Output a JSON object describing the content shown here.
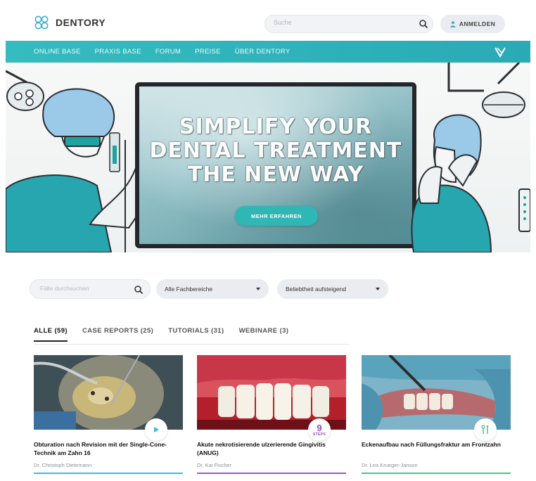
{
  "header": {
    "brand": "DENTORY",
    "search_placeholder": "Suche",
    "login_label": "ANMELDEN"
  },
  "nav": {
    "items": [
      "ONLINE BASE",
      "PRAXIS BASE",
      "FORUM",
      "PREISE",
      "ÜBER DENTORY"
    ]
  },
  "hero": {
    "line1": "SIMPLIFY YOUR",
    "line2": "DENTAL TREATMENT",
    "line3": "THE NEW WAY",
    "cta_label": "MEHR ERFAHREN"
  },
  "filters": {
    "search_placeholder": "Fälle durchsuchen",
    "category_value": "Alle Fachbereiche",
    "sort_value": "Beliebtheit aufsteigend"
  },
  "tabs": [
    {
      "label": "ALLE (59)",
      "active": true
    },
    {
      "label": "CASE REPORTS (25)",
      "active": false
    },
    {
      "label": "TUTORIALS (31)",
      "active": false
    },
    {
      "label": "WEBINARE (3)",
      "active": false
    }
  ],
  "cards": [
    {
      "title": "Obturation nach Revision mit der Single-Cone-Technik am Zahn 16",
      "author": "Dr. Christoph Dietemann",
      "badge_icon": "play-icon",
      "accent": "#3fb8e0"
    },
    {
      "title": "Akute nekrotisierende ulzerierende Gingivitis (ANUG)",
      "author": "Dr. Kai Fischer",
      "badge_steps": "9",
      "badge_steps_label": "STEPS",
      "accent": "#9b59c5"
    },
    {
      "title": "Eckenaufbau nach Füllungsfraktur am Frontzahn",
      "author": "Dr. Lea Krueger-Janson",
      "badge_icon": "dental-tools-icon",
      "accent": "#4cc18a"
    }
  ],
  "colors": {
    "brand_teal": "#2fb7b6",
    "nav_bg": "#35bcbf"
  }
}
